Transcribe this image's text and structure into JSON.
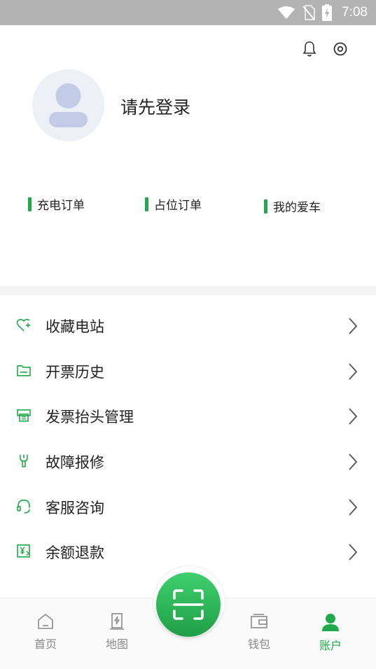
{
  "status_bar": {
    "time": "7:08"
  },
  "profile": {
    "login_prompt": "请先登录"
  },
  "quick_links": [
    {
      "label": "充电订单"
    },
    {
      "label": "占位订单"
    },
    {
      "label": "我的爱车"
    }
  ],
  "menu": [
    {
      "label": "收藏电站",
      "icon": "heart-plus-icon"
    },
    {
      "label": "开票历史",
      "icon": "folder-icon"
    },
    {
      "label": "发票抬头管理",
      "icon": "printer-icon"
    },
    {
      "label": "故障报修",
      "icon": "wrench-icon"
    },
    {
      "label": "客服咨询",
      "icon": "headset-icon"
    },
    {
      "label": "余额退款",
      "icon": "yen-refund-icon"
    }
  ],
  "tabbar": {
    "tabs": [
      {
        "label": "首页",
        "icon": "home-icon"
      },
      {
        "label": "地图",
        "icon": "charging-pile-icon"
      },
      {
        "label": "钱包",
        "icon": "wallet-icon"
      },
      {
        "label": "账户",
        "icon": "person-icon"
      }
    ],
    "active_index": 3,
    "scan_icon": "scan-icon"
  },
  "colors": {
    "accent": "#1faa4b",
    "status_bar": "#b3b3b3",
    "tab_inactive": "#8a8a8a",
    "avatar_bg": "#eef0f7",
    "avatar_fg": "#c3cbe6"
  }
}
